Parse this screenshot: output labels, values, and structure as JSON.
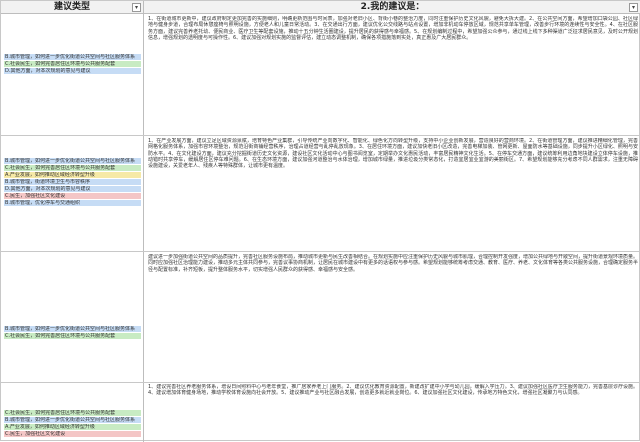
{
  "header": {
    "left_title": "建议类型",
    "right_title": "2.我的建议是：",
    "filter_glyph": "▾"
  },
  "colors": {
    "blue": "#c6dcf5",
    "green": "#c8ebc3",
    "yellow": "#f6e9a6",
    "red": "#f4c6c6",
    "header_bg": "#f2f2f2"
  },
  "rows": [
    {
      "tags": [
        {
          "text": "B.城市管理，如何进一步优化街道公共空间与社区服务体系",
          "color": "blue"
        },
        {
          "text": "C.社会民生，如何完善居住区环境与公共服务配套",
          "color": "green"
        },
        {
          "text": "D.其他方面，对本次规划的意见与建议",
          "color": "blue"
        }
      ],
      "text": "1、在街道城市更新中，建议政府制定更加完善的实施细则，明确更新范围与时间表，加强对老旧小区、背街小巷的整治力度，同时注重保护历史文化风貌，避免大拆大建。2、在公共空间方面，希望增加口袋公园、社区绿地与健身步道，合理布局休憩座椅与照明设施，方便老人和儿童日常活动。3、在交通出行方面，建议优化公交线路与站点设置，增加非机动车停放区域，规范共享单车管理，改善步行环境的连续性与安全性。4、在社区服务方面，建议完善养老托幼、便民商业、医疗卫生等配套设施，推动十五分钟生活圈建设，提升居民的获得感与幸福感。5、在规划编制过程中，希望加强公众参与，通过线上线下多种渠道广泛征求居民意见，及时公开规划信息，增强规划的透明度与可操作性。6、建议加强对规划实施的监督评估，建立动态调整机制，确保各项措施落到实处，真正惠及广大居民群众。"
    },
    {
      "tags": [
        {
          "text": "B.城市管理，如何进一步优化街道公共空间与社区服务体系",
          "color": "blue"
        },
        {
          "text": "C.社会民生，如何完善居住区环境与公共服务配套",
          "color": "green"
        },
        {
          "text": "A.产业发展，如何推动区域经济转型升级",
          "color": "yellow"
        },
        {
          "text": "B.城市管理，街道环境卫生与市容秩序",
          "color": "blue"
        },
        {
          "text": "D.其他方面，对本次规划的意见与建议",
          "color": "blue"
        },
        {
          "text": "C.民生，加强社区文化建设",
          "color": "red"
        },
        {
          "text": "B.城市管理，优化停车与交通组织",
          "color": "blue"
        }
      ],
      "text": "1、在产业发展方面，建议立足区域资源禀赋，培育特色产业集群，引导传统产业向数字化、智能化、绿色化方向转型升级，支持中小企业创新发展，营造良好的营商环境。2、在街道管理方面，建议推进精细化管理，完善网格化服务体系，加强市容环境整治，规范沿街商铺经营秩序，治理占道经营与乱停乱放现象。3、在居住环境方面，建议加快老旧小区改造，完善电梯加装、管网更新、屋面防水等基础设施，同步提升小区绿化、照明与安防水平。4、在文化建设方面，建议充分挖掘街道历史文化资源，建设社区文化活动中心与图书阅览室，定期举办文化惠民活动，丰富居民精神文化生活。5、在停车交通方面，建议统筹利用边角地块建设立体停车设施，推动错时共享停车，缓解居住区停车难问题。6、在生态环境方面，建议加强河道整治与水体治理，增加城市绿量，推进垃圾分类常态化，打造宜居宜业宜游的美丽街区。7、希望规划能够充分考虑不同人群需求，注重无障碍设施建设，关爱老年人、残疾人等特殊群体，让城市更有温度。"
    },
    {
      "tags": [
        {
          "text": "B.城市管理，如何进一步优化街道公共空间与社区服务体系",
          "color": "blue"
        },
        {
          "text": "C.社会民生，如何完善居住区环境与公共服务配套",
          "color": "green"
        }
      ],
      "text": "建议进一步加强街道公共空间的品质提升，完善社区服务设施布局，推动城市更新与民生改善相结合。在规划实施中应注重保护历史风貌与城市肌理，合理控制开发强度，增加公共绿地与开敞空间，提升街道景观环境质量。同时应加强社区治理能力建设，推动多元主体共同参与，完善议事协商机制，让居民在城市建设中有更多的话语权与参与感。希望规划能够统筹考虑交通、教育、医疗、养老、文化体育等各类公共服务设施，合理确定服务半径与配置标准，补齐短板，提升整体服务水平，切实增强人民群众的获得感、幸福感与安全感。"
    },
    {
      "tags": [
        {
          "text": "C.社会民生，如何完善居住区环境与公共服务配套",
          "color": "green"
        },
        {
          "text": "B.城市管理，如何进一步优化街道公共空间与社区服务体系",
          "color": "blue"
        },
        {
          "text": "A.产业发展，如何推动区域经济转型升级",
          "color": "green"
        },
        {
          "text": "C.民生，加强社区文化建设",
          "color": "red"
        }
      ],
      "text": "1、建议完善社区养老服务体系，增设日间照料中心与老年食堂，推广居家养老上门服务。2、建议优化教育资源配置，新建改扩建中小学与幼儿园，缓解入学压力。3、建议加强社区医疗卫生服务能力，完善基层诊疗设施。4、建议增加体育健身场地，推动学校体育设施向社会开放。5、建议推动产业与社区融合发展，创造更多就近就业岗位。6、建议加强社区文化建设，传承地方特色文化，增强社区凝聚力与认同感。"
    }
  ]
}
